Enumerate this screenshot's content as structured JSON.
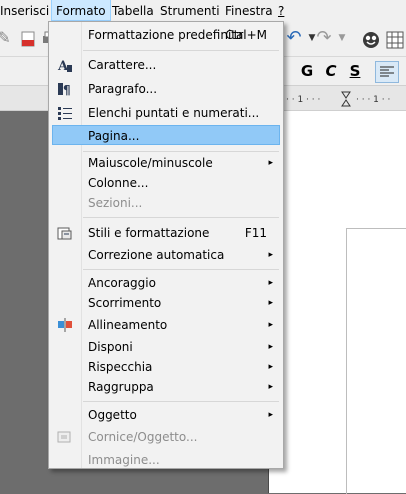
{
  "menubar": {
    "items": [
      "Inserisci",
      "Formato",
      "Tabella",
      "Strumenti",
      "Finestra",
      "?"
    ],
    "active": "Formato"
  },
  "toolbar": {
    "font_buttons": [
      "G",
      "C",
      "S"
    ]
  },
  "menu": {
    "items": [
      {
        "label": "Formattazione predefinita",
        "shortcut": "Ctrl+M",
        "icon": "none",
        "submenu": false,
        "disabled": false
      },
      {
        "label": "Carattere...",
        "icon": "character-icon",
        "submenu": false,
        "disabled": false
      },
      {
        "label": "Paragrafo...",
        "icon": "paragraph-icon",
        "submenu": false,
        "disabled": false
      },
      {
        "label": "Elenchi puntati e numerati...",
        "icon": "bullets-numbering-icon",
        "submenu": false,
        "disabled": false
      },
      {
        "label": "Pagina...",
        "icon": "none",
        "submenu": false,
        "disabled": false,
        "highlighted": true
      },
      {
        "label": "Maiuscole/minuscole",
        "icon": "none",
        "submenu": true,
        "disabled": false
      },
      {
        "label": "Colonne...",
        "icon": "none",
        "submenu": false,
        "disabled": false
      },
      {
        "label": "Sezioni...",
        "icon": "none",
        "submenu": false,
        "disabled": true
      },
      {
        "label": "Stili e formattazione",
        "shortcut": "F11",
        "icon": "styles-icon",
        "submenu": false,
        "disabled": false
      },
      {
        "label": "Correzione automatica",
        "icon": "none",
        "submenu": true,
        "disabled": false
      },
      {
        "label": "Ancoraggio",
        "icon": "none",
        "submenu": true,
        "disabled": false
      },
      {
        "label": "Scorrimento",
        "icon": "none",
        "submenu": true,
        "disabled": false
      },
      {
        "label": "Allineamento",
        "icon": "alignment-icon",
        "submenu": true,
        "disabled": false
      },
      {
        "label": "Disponi",
        "icon": "none",
        "submenu": true,
        "disabled": false
      },
      {
        "label": "Rispecchia",
        "icon": "none",
        "submenu": true,
        "disabled": false
      },
      {
        "label": "Raggruppa",
        "icon": "none",
        "submenu": true,
        "disabled": false
      },
      {
        "label": "Oggetto",
        "icon": "none",
        "submenu": true,
        "disabled": false
      },
      {
        "label": "Cornice/Oggetto...",
        "icon": "frame-icon",
        "submenu": false,
        "disabled": true
      },
      {
        "label": "Immagine...",
        "icon": "none",
        "submenu": false,
        "disabled": true
      }
    ]
  }
}
